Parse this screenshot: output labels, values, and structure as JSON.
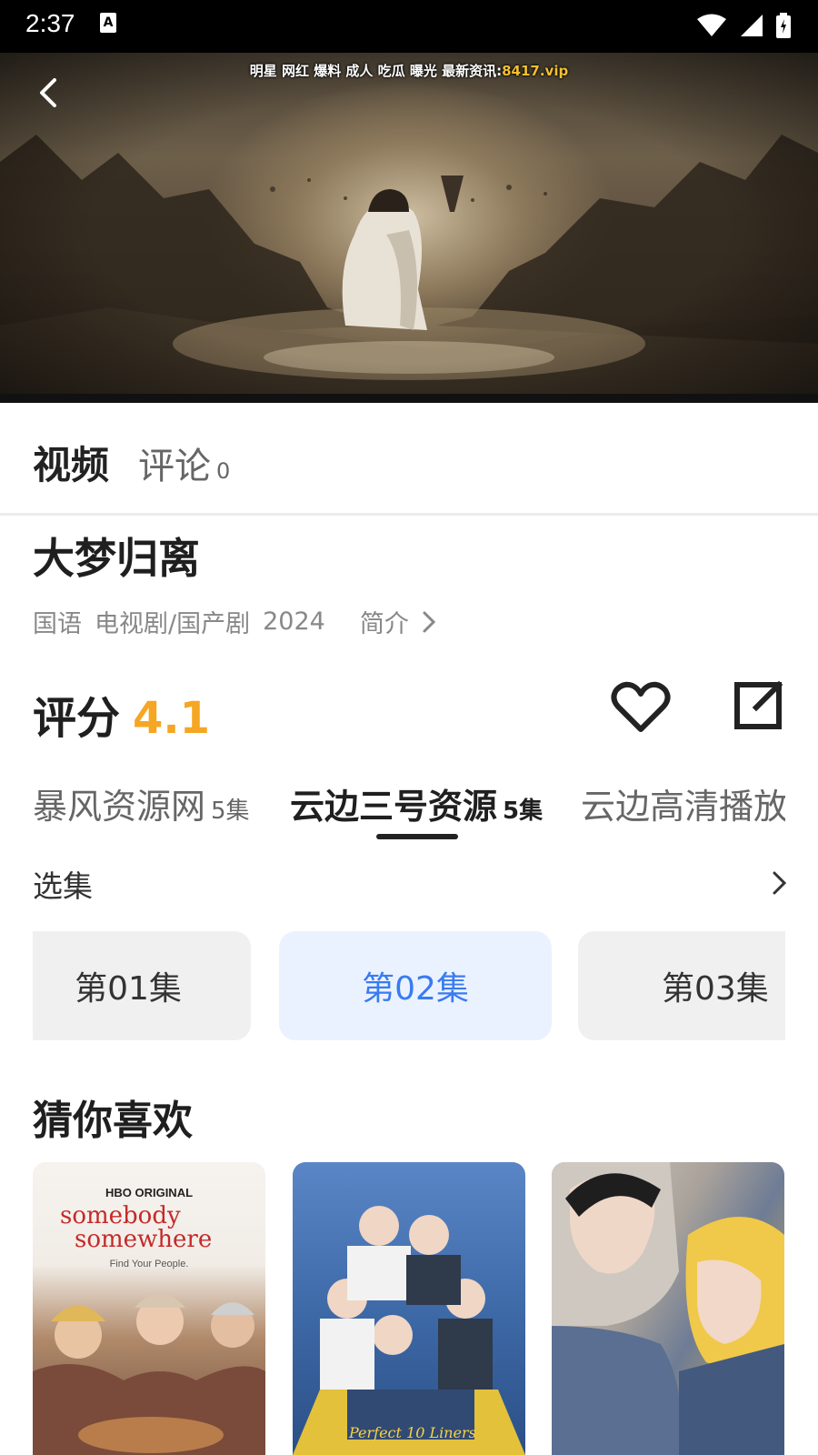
{
  "status_bar": {
    "time": "2:37",
    "icons": [
      "a-icon",
      "wifi-icon",
      "signal-icon",
      "battery-icon"
    ]
  },
  "player": {
    "watermark_prefix": "明星 网红 爆料 成人 吃瓜 曝光 最新资讯:",
    "watermark_site": "8417.vip"
  },
  "tabs": {
    "video_label": "视频",
    "comments_label": "评论",
    "comments_count": "0"
  },
  "show": {
    "title": "大梦归离",
    "language": "国语",
    "genre": "电视剧/国产剧",
    "year": "2024",
    "intro_label": "简介"
  },
  "rating": {
    "label": "评分",
    "score": "4.1"
  },
  "sources": [
    {
      "name": "暴风资源网",
      "episodes": "5集"
    },
    {
      "name": "云边三号资源",
      "episodes": "5集"
    },
    {
      "name": "云边高清播放",
      "episodes": ""
    }
  ],
  "episodes": {
    "header": "选集",
    "items": [
      "第01集",
      "第02集",
      "第03集"
    ]
  },
  "recommend": {
    "title": "猜你喜欢",
    "poster1_brand": "HBO ORIGINAL",
    "poster1_title_line1": "somebody",
    "poster1_title_line2": "somewhere",
    "poster1_tagline": "Find Your People.",
    "poster2_title": "Perfect 10 Liners"
  },
  "colors": {
    "score": "#f5a623",
    "episode_active_bg": "#ebf2ff",
    "episode_active_text": "#3a7bf0",
    "watermark_site": "#f2c12e"
  }
}
